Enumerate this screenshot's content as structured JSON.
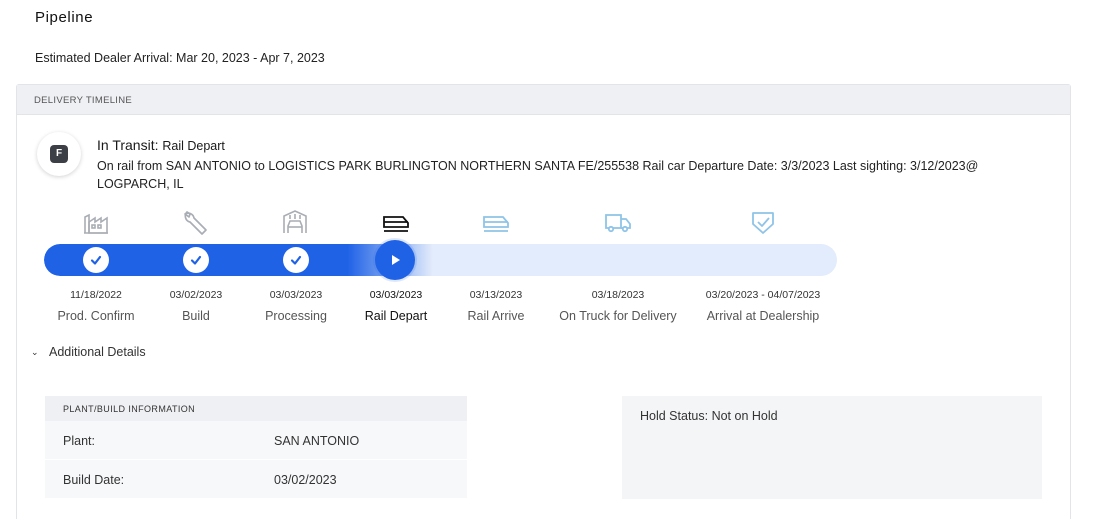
{
  "page": {
    "title": "Pipeline",
    "eta_label": "Estimated Dealer Arrival:",
    "eta_value": "Mar 20, 2023 - Apr 7, 2023"
  },
  "timeline": {
    "header": "DELIVERY TIMELINE",
    "badge_letter": "F",
    "status_label": "In Transit:",
    "status_sub": "Rail Depart",
    "detail": "On rail from SAN ANTONIO to LOGISTICS PARK BURLINGTON NORTHERN SANTA FE/255538 Rail car Departure Date: 3/3/2023 Last sighting: 3/12/2023@ LOGPARCH, IL",
    "progress_fraction": 0.49,
    "stages": [
      {
        "name": "Prod. Confirm",
        "date": "11/18/2022",
        "icon": "factory-icon",
        "state": "complete"
      },
      {
        "name": "Build",
        "date": "03/02/2023",
        "icon": "wrench-icon",
        "state": "complete"
      },
      {
        "name": "Processing",
        "date": "03/03/2023",
        "icon": "car-wash-icon",
        "state": "complete"
      },
      {
        "name": "Rail Depart",
        "date": "03/03/2023",
        "icon": "train-icon",
        "state": "current"
      },
      {
        "name": "Rail Arrive",
        "date": "03/13/2023",
        "icon": "train-icon",
        "state": "upcoming"
      },
      {
        "name": "On Truck for Delivery",
        "date": "03/18/2023",
        "icon": "truck-icon",
        "state": "upcoming"
      },
      {
        "name": "Arrival at Dealership",
        "date": "03/20/2023 - 04/07/2023",
        "icon": "shield-check-icon",
        "state": "upcoming"
      }
    ]
  },
  "details": {
    "toggle_label": "Additional Details",
    "plant_header": "PLANT/BUILD INFORMATION",
    "rows": [
      {
        "key": "Plant:",
        "value": "SAN ANTONIO"
      },
      {
        "key": "Build Date:",
        "value": "03/02/2023"
      }
    ],
    "hold_status": "Hold Status: Not on Hold"
  },
  "colors": {
    "accent": "#1f62e6",
    "track": "#e3ecfc",
    "complete_icon": "#a9adb4",
    "upcoming_icon": "#8fc4e8",
    "current_icon": "#111111"
  }
}
